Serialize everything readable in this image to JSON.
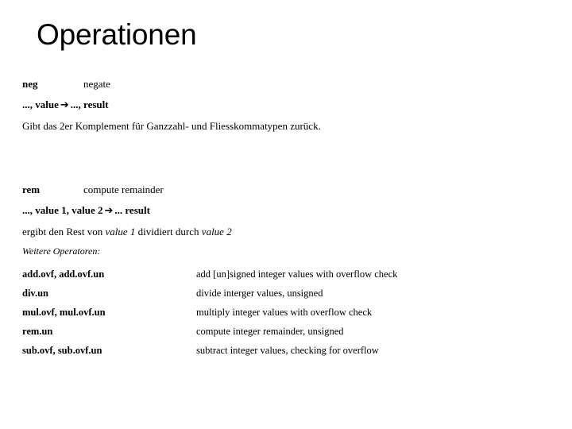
{
  "slide": {
    "title": "Operationen",
    "background_color": "#ffffff",
    "text_color": "#000000"
  },
  "operations": [
    {
      "mnemonic": "neg",
      "gloss": "negate",
      "signature_before": "..., value",
      "arrow": "➔",
      "signature_after": "..., result",
      "description": "Gibt das 2er Komplement für Ganzzahl- und Fliesskommatypen zurück."
    },
    {
      "mnemonic": "rem",
      "gloss": "compute remainder",
      "signature_before": "..., value 1, value 2",
      "arrow": "➔",
      "signature_after": "... result",
      "description_prefix": "ergibt den Rest von ",
      "description_italic_1": "value 1",
      "description_middle": " dividiert durch ",
      "description_italic_2": "value 2"
    }
  ],
  "further_operators": {
    "heading": "Weitere Operatoren:",
    "rows": [
      {
        "name": "add.ovf, add.ovf.un",
        "description": "add [un]signed integer values with overflow check"
      },
      {
        "name": "div.un",
        "description": "divide interger values, unsigned"
      },
      {
        "name": "mul.ovf, mul.ovf.un",
        "description": "multiply integer values with overflow check"
      },
      {
        "name": "rem.un",
        "description": "compute integer remainder, unsigned"
      },
      {
        "name": "sub.ovf, sub.ovf.un",
        "description": "subtract integer values, checking for overflow"
      }
    ]
  }
}
